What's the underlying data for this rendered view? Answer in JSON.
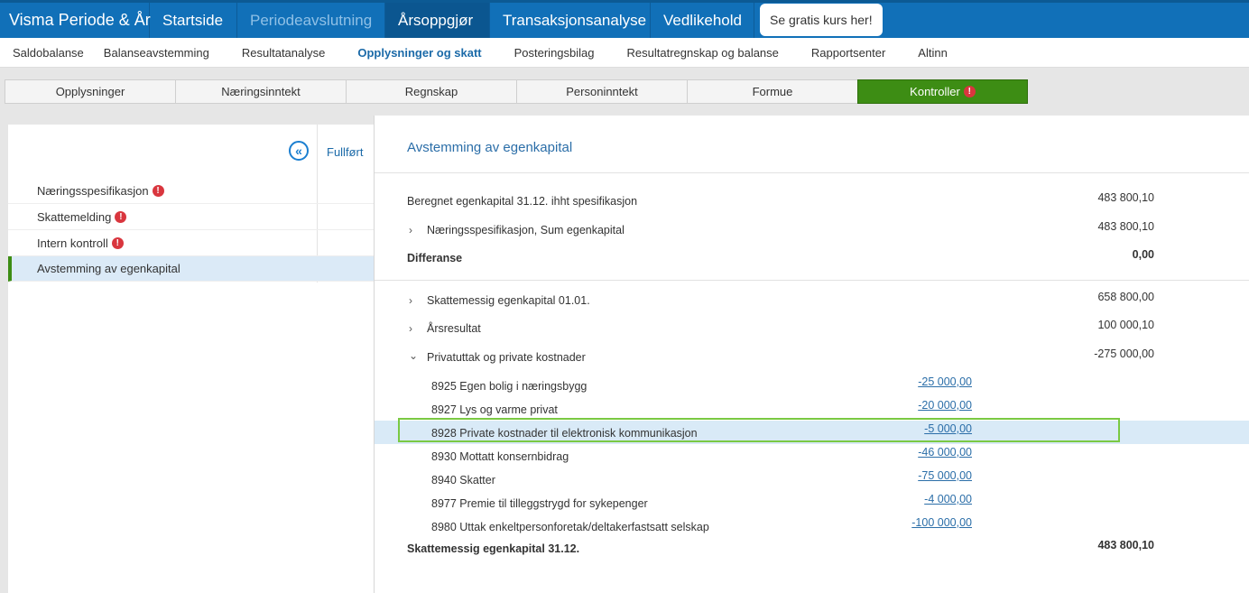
{
  "topnav": {
    "brand": "Visma Periode & År",
    "items": [
      "Startside",
      "Periodeavslutning",
      "Årsoppgjør",
      "Transaksjonsanalyse",
      "Vedlikehold"
    ],
    "promo": "Se gratis kurs her!"
  },
  "subnav": {
    "items": [
      "Saldobalanse",
      "Balanseavstemming",
      "Resultatanalyse",
      "Opplysninger og skatt",
      "Posteringsbilag",
      "Resultatregnskap og balanse",
      "Rapportsenter",
      "Altinn"
    ]
  },
  "tabs": [
    "Opplysninger",
    "Næringsinntekt",
    "Regnskap",
    "Personinntekt",
    "Formue",
    "Kontroller"
  ],
  "left": {
    "fullfort": "Fullført",
    "items": [
      "Næringsspesifikasjon",
      "Skattemelding",
      "Intern kontroll",
      "Avstemming av egenkapital"
    ]
  },
  "main": {
    "title": "Avstemming av egenkapital",
    "beregnet_label": "Beregnet egenkapital 31.12. ihht spesifikasjon",
    "beregnet_value": "483 800,10",
    "naering_label": "Næringsspesifikasjon, Sum egenkapital",
    "naering_value": "483 800,10",
    "differanse_label": "Differanse",
    "differanse_value": "0,00",
    "skatt0101_label": "Skattemessig egenkapital 01.01.",
    "skatt0101_value": "658 800,00",
    "aarsresultat_label": "Årsresultat",
    "aarsresultat_value": "100 000,10",
    "privat_label": "Privatuttak og private kostnader",
    "privat_value": "-275 000,00",
    "sub_rows": [
      {
        "label": "8925 Egen bolig i næringsbygg",
        "value": "-25 000,00"
      },
      {
        "label": "8927 Lys og varme privat",
        "value": "-20 000,00"
      },
      {
        "label": "8928 Private kostnader til elektronisk kommunikasjon",
        "value": "-5 000,00"
      },
      {
        "label": "8930 Mottatt konsernbidrag",
        "value": "-46 000,00"
      },
      {
        "label": "8940 Skatter",
        "value": "-75 000,00"
      },
      {
        "label": "8977 Premie til tilleggstrygd for sykepenger",
        "value": "-4 000,00"
      },
      {
        "label": "8980 Uttak enkeltpersonforetak/deltakerfastsatt selskap",
        "value": "-100 000,00"
      }
    ],
    "skatt3112_label": "Skattemessig egenkapital 31.12.",
    "skatt3112_value": "483 800,10"
  }
}
